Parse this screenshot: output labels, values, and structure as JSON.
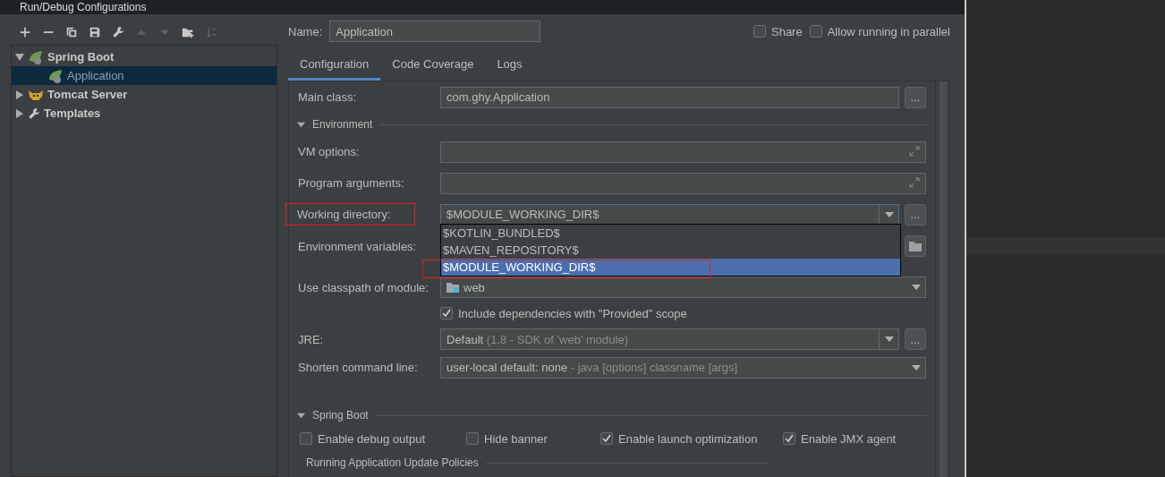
{
  "window": {
    "title": "Run/Debug Configurations"
  },
  "toolbar": {
    "items": [
      {
        "disabled": false
      },
      {
        "disabled": false
      },
      {
        "disabled": false
      },
      {
        "disabled": false
      },
      {
        "disabled": false
      },
      {
        "disabled": true
      },
      {
        "disabled": true
      },
      {
        "disabled": false
      },
      {
        "disabled": true
      }
    ]
  },
  "tree": [
    {
      "label": "Spring Boot",
      "kind": "spring",
      "expanded": true,
      "selected": false,
      "children": [
        {
          "label": "Application",
          "kind": "spring",
          "selected": true
        }
      ]
    },
    {
      "label": "Tomcat Server",
      "kind": "tomcat",
      "expanded": false,
      "selected": false
    },
    {
      "label": "Templates",
      "kind": "templates",
      "expanded": false,
      "selected": false
    }
  ],
  "name": {
    "label": "Name:",
    "value": "Application"
  },
  "header_options": [
    {
      "label": "Share",
      "checked": false
    },
    {
      "label": "Allow running in parallel",
      "checked": false
    }
  ],
  "tabs": [
    {
      "label": "Configuration",
      "selected": true
    },
    {
      "label": "Code Coverage",
      "selected": false
    },
    {
      "label": "Logs",
      "selected": false
    }
  ],
  "main_class": {
    "label": "Main class:",
    "value": "com.ghy.Application",
    "button": "..."
  },
  "environment": {
    "title": "Environment",
    "expanded": true
  },
  "vm_options": {
    "label": "VM options:"
  },
  "program_arguments": {
    "label": "Program arguments:"
  },
  "working_directory": {
    "label": "Working directory:",
    "value": "$MODULE_WORKING_DIR$",
    "button": "...",
    "annotated": true,
    "options": [
      {
        "label": "$KOTLIN_BUNDLED$",
        "selected": false,
        "annotated": false
      },
      {
        "label": "$MAVEN_REPOSITORY$",
        "selected": false,
        "annotated": false
      },
      {
        "label": "$MODULE_WORKING_DIR$",
        "selected": true,
        "annotated": true
      }
    ]
  },
  "environment_variables": {
    "label": "Environment variables:"
  },
  "classpath_module": {
    "label": "Use classpath of module:",
    "value": "web"
  },
  "include_provided": {
    "label": "Include dependencies with \"Provided\" scope",
    "checked": true
  },
  "jre": {
    "label": "JRE:",
    "value": "Default",
    "button": "...",
    "detail": "(1.8 - SDK of 'web' module)"
  },
  "shorten_command_line": {
    "label": "Shorten command line:",
    "value": "user-local default: none",
    "detail": "- java [options] classname [args]"
  },
  "spring_boot": {
    "title": "Spring Boot",
    "expanded": true,
    "options": [
      {
        "label": "Enable debug output",
        "checked": false
      },
      {
        "label": "Hide banner",
        "checked": false
      },
      {
        "label": "Enable launch optimization",
        "checked": true
      },
      {
        "label": "Enable JMX agent",
        "checked": true
      }
    ]
  },
  "update_policies": {
    "title": "Running Application Update Policies"
  }
}
